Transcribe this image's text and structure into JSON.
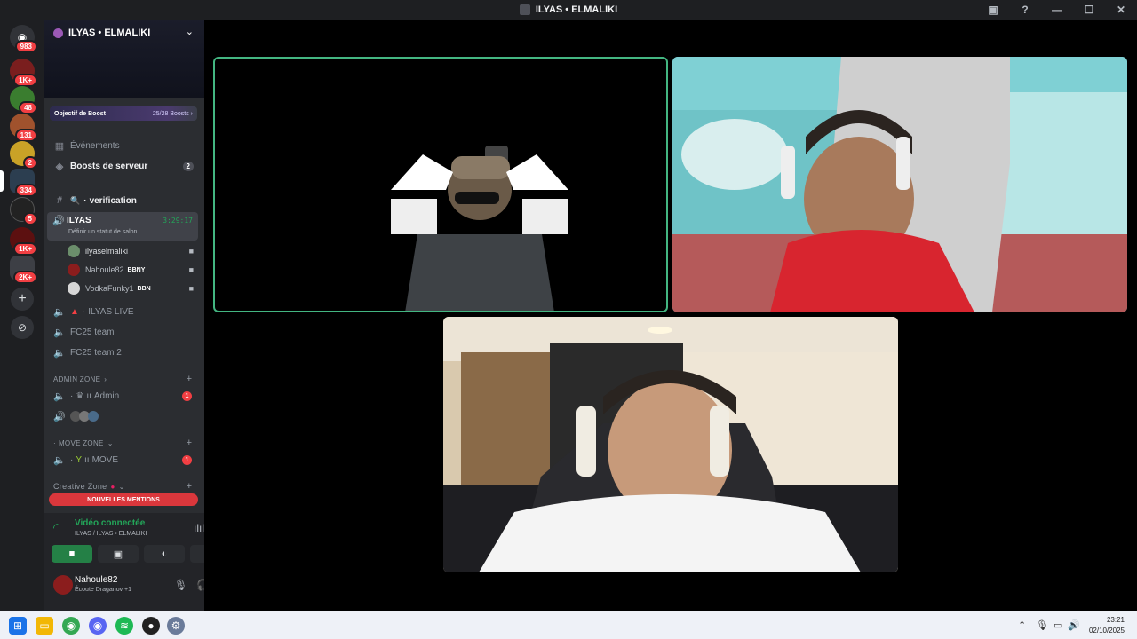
{
  "window": {
    "title": "ILYAS • ELMALIKI"
  },
  "rail": {
    "badges": [
      "983",
      "1K+",
      "48",
      "131",
      "2",
      "334",
      "5",
      "1K+",
      "2K+"
    ]
  },
  "server": {
    "name": "ILYAS • ELMALIKI",
    "boost_label": "Objectif de Boost",
    "boost_value": "25/28 Boosts ›"
  },
  "channels": {
    "events": "Événements",
    "boosts": "Boosts de serveur",
    "boosts_count": "2",
    "verification": "verification",
    "active": {
      "name": "ILYAS",
      "time": "3:29:17",
      "status": "Définir un statut de salon"
    },
    "voice_users": [
      {
        "name": "ilyaselmaliki",
        "tag": ""
      },
      {
        "name": "Nahoule82",
        "tag": "BBNY"
      },
      {
        "name": "VodkaFunky1",
        "tag": "BBN"
      }
    ],
    "ilyas_live": "ILYAS LIVE",
    "fc25": "FC25 team",
    "fc25_2": "FC25 team 2",
    "admin_zone": "ADMIN ZONE",
    "admin": "Admin",
    "admin_badge": "1",
    "move_zone": "MOVE ZONE",
    "move": "MOVE",
    "move_badge": "1",
    "creative_zone": "Creative Zone",
    "new_mentions": "NOUVELLES MENTIONS"
  },
  "voice": {
    "title": "Vidéo connectée",
    "subtitle": "ILYAS / ILYAS • ELMALIKI"
  },
  "user": {
    "name": "Nahoule82",
    "status": "Écoute Draganov +1"
  },
  "taskbar": {
    "time": "23:21",
    "date": "02/10/2025"
  },
  "colors": {
    "accent_green": "#23a559",
    "mention_red": "#da373c",
    "sidebar_bg": "#2b2d31",
    "rail_bg": "#1e1f22"
  }
}
